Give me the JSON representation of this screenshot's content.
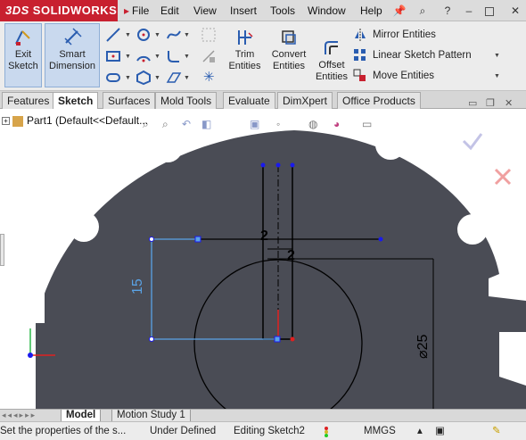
{
  "app": {
    "logo_brand": "3DS",
    "logo_text": "SOLIDWORKS"
  },
  "menu": [
    "File",
    "Edit",
    "View",
    "Insert",
    "Tools",
    "Window",
    "Help"
  ],
  "toolbar": {
    "exit_sketch_line1": "Exit",
    "exit_sketch_line2": "Sketch",
    "smart_dimension_line1": "Smart",
    "smart_dimension_line2": "Dimension",
    "trim_line1": "Trim",
    "trim_line2": "Entities",
    "convert_line1": "Convert",
    "convert_line2": "Entities",
    "offset_line1": "Offset",
    "offset_line2": "Entities",
    "mirror": "Mirror Entities",
    "linear_pattern": "Linear Sketch Pattern",
    "move": "Move Entities"
  },
  "tabs": [
    "Features",
    "Sketch",
    "Surfaces",
    "Mold Tools",
    "Evaluate",
    "DimXpert",
    "Office Products"
  ],
  "active_tab": "Sketch",
  "tree": {
    "root": "Part1  (Default<<Default..."
  },
  "dimensions": {
    "d1": "2",
    "d2": "2",
    "height": "15",
    "diameter": "⌀25"
  },
  "bottom_tabs": [
    "Model",
    "Motion Study 1"
  ],
  "status": {
    "hint": "Set the properties of the s...",
    "definition": "Under Defined",
    "editing": "Editing Sketch2",
    "units": "MMGS"
  },
  "colors": {
    "part_face": "#4a4c55",
    "sketch_blue": "#5aa3e6",
    "sketch_black": "#000000",
    "point_blue": "#1a1aee",
    "brand_red": "#c8202f"
  }
}
